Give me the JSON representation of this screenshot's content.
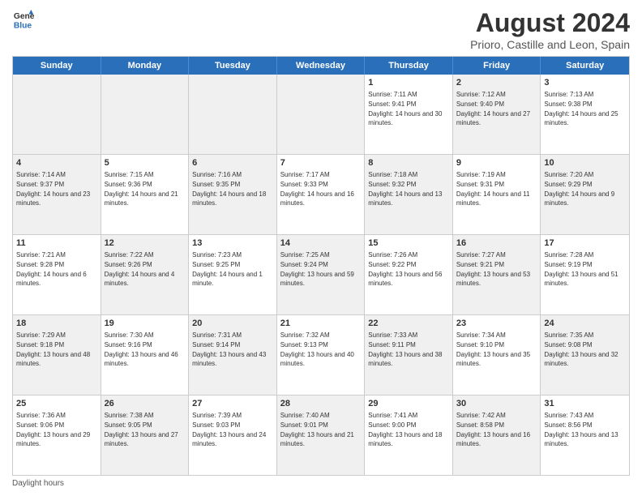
{
  "header": {
    "logo_line1": "General",
    "logo_line2": "Blue",
    "title": "August 2024",
    "subtitle": "Prioro, Castille and Leon, Spain"
  },
  "days": [
    "Sunday",
    "Monday",
    "Tuesday",
    "Wednesday",
    "Thursday",
    "Friday",
    "Saturday"
  ],
  "weeks": [
    [
      {
        "day": "",
        "info": "",
        "shaded": true
      },
      {
        "day": "",
        "info": "",
        "shaded": true
      },
      {
        "day": "",
        "info": "",
        "shaded": true
      },
      {
        "day": "",
        "info": "",
        "shaded": true
      },
      {
        "day": "1",
        "info": "Sunrise: 7:11 AM\nSunset: 9:41 PM\nDaylight: 14 hours and 30 minutes."
      },
      {
        "day": "2",
        "info": "Sunrise: 7:12 AM\nSunset: 9:40 PM\nDaylight: 14 hours and 27 minutes.",
        "shaded": true
      },
      {
        "day": "3",
        "info": "Sunrise: 7:13 AM\nSunset: 9:38 PM\nDaylight: 14 hours and 25 minutes."
      }
    ],
    [
      {
        "day": "4",
        "info": "Sunrise: 7:14 AM\nSunset: 9:37 PM\nDaylight: 14 hours and 23 minutes.",
        "shaded": true
      },
      {
        "day": "5",
        "info": "Sunrise: 7:15 AM\nSunset: 9:36 PM\nDaylight: 14 hours and 21 minutes."
      },
      {
        "day": "6",
        "info": "Sunrise: 7:16 AM\nSunset: 9:35 PM\nDaylight: 14 hours and 18 minutes.",
        "shaded": true
      },
      {
        "day": "7",
        "info": "Sunrise: 7:17 AM\nSunset: 9:33 PM\nDaylight: 14 hours and 16 minutes."
      },
      {
        "day": "8",
        "info": "Sunrise: 7:18 AM\nSunset: 9:32 PM\nDaylight: 14 hours and 13 minutes.",
        "shaded": true
      },
      {
        "day": "9",
        "info": "Sunrise: 7:19 AM\nSunset: 9:31 PM\nDaylight: 14 hours and 11 minutes."
      },
      {
        "day": "10",
        "info": "Sunrise: 7:20 AM\nSunset: 9:29 PM\nDaylight: 14 hours and 9 minutes.",
        "shaded": true
      }
    ],
    [
      {
        "day": "11",
        "info": "Sunrise: 7:21 AM\nSunset: 9:28 PM\nDaylight: 14 hours and 6 minutes."
      },
      {
        "day": "12",
        "info": "Sunrise: 7:22 AM\nSunset: 9:26 PM\nDaylight: 14 hours and 4 minutes.",
        "shaded": true
      },
      {
        "day": "13",
        "info": "Sunrise: 7:23 AM\nSunset: 9:25 PM\nDaylight: 14 hours and 1 minute."
      },
      {
        "day": "14",
        "info": "Sunrise: 7:25 AM\nSunset: 9:24 PM\nDaylight: 13 hours and 59 minutes.",
        "shaded": true
      },
      {
        "day": "15",
        "info": "Sunrise: 7:26 AM\nSunset: 9:22 PM\nDaylight: 13 hours and 56 minutes."
      },
      {
        "day": "16",
        "info": "Sunrise: 7:27 AM\nSunset: 9:21 PM\nDaylight: 13 hours and 53 minutes.",
        "shaded": true
      },
      {
        "day": "17",
        "info": "Sunrise: 7:28 AM\nSunset: 9:19 PM\nDaylight: 13 hours and 51 minutes."
      }
    ],
    [
      {
        "day": "18",
        "info": "Sunrise: 7:29 AM\nSunset: 9:18 PM\nDaylight: 13 hours and 48 minutes.",
        "shaded": true
      },
      {
        "day": "19",
        "info": "Sunrise: 7:30 AM\nSunset: 9:16 PM\nDaylight: 13 hours and 46 minutes."
      },
      {
        "day": "20",
        "info": "Sunrise: 7:31 AM\nSunset: 9:14 PM\nDaylight: 13 hours and 43 minutes.",
        "shaded": true
      },
      {
        "day": "21",
        "info": "Sunrise: 7:32 AM\nSunset: 9:13 PM\nDaylight: 13 hours and 40 minutes."
      },
      {
        "day": "22",
        "info": "Sunrise: 7:33 AM\nSunset: 9:11 PM\nDaylight: 13 hours and 38 minutes.",
        "shaded": true
      },
      {
        "day": "23",
        "info": "Sunrise: 7:34 AM\nSunset: 9:10 PM\nDaylight: 13 hours and 35 minutes."
      },
      {
        "day": "24",
        "info": "Sunrise: 7:35 AM\nSunset: 9:08 PM\nDaylight: 13 hours and 32 minutes.",
        "shaded": true
      }
    ],
    [
      {
        "day": "25",
        "info": "Sunrise: 7:36 AM\nSunset: 9:06 PM\nDaylight: 13 hours and 29 minutes."
      },
      {
        "day": "26",
        "info": "Sunrise: 7:38 AM\nSunset: 9:05 PM\nDaylight: 13 hours and 27 minutes.",
        "shaded": true
      },
      {
        "day": "27",
        "info": "Sunrise: 7:39 AM\nSunset: 9:03 PM\nDaylight: 13 hours and 24 minutes."
      },
      {
        "day": "28",
        "info": "Sunrise: 7:40 AM\nSunset: 9:01 PM\nDaylight: 13 hours and 21 minutes.",
        "shaded": true
      },
      {
        "day": "29",
        "info": "Sunrise: 7:41 AM\nSunset: 9:00 PM\nDaylight: 13 hours and 18 minutes."
      },
      {
        "day": "30",
        "info": "Sunrise: 7:42 AM\nSunset: 8:58 PM\nDaylight: 13 hours and 16 minutes.",
        "shaded": true
      },
      {
        "day": "31",
        "info": "Sunrise: 7:43 AM\nSunset: 8:56 PM\nDaylight: 13 hours and 13 minutes."
      }
    ]
  ],
  "footer": "Daylight hours"
}
